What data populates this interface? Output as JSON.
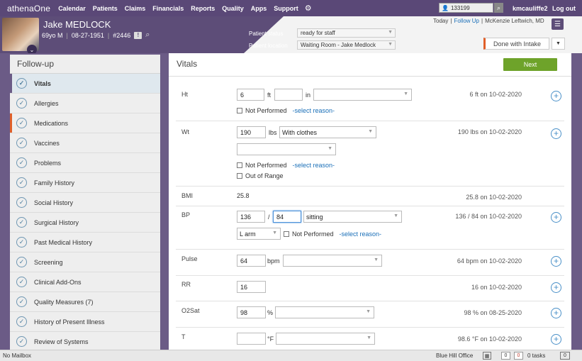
{
  "nav": {
    "logo": "athenaOne",
    "items": [
      "Calendar",
      "Patients",
      "Claims",
      "Financials",
      "Reports",
      "Quality",
      "Apps",
      "Support"
    ],
    "search_value": "133199",
    "username": "kmcauliffe2",
    "logout": "Log out"
  },
  "patient": {
    "name": "Jake MEDLOCK",
    "age_sex": "69yo M",
    "dob": "08-27-1951",
    "id": "#2446",
    "status_label": "Patient status",
    "status_value": "ready for staff",
    "location_label": "Patient location",
    "location_value": "Waiting Room - Jake Medlock"
  },
  "header_right": {
    "today": "Today",
    "sep": "|",
    "follow_up": "Follow Up",
    "provider": "McKenzie Leftwich, MD",
    "done_button": "Done with Intake"
  },
  "sidebar": {
    "title": "Follow-up",
    "items": [
      "Vitals",
      "Allergies",
      "Medications",
      "Vaccines",
      "Problems",
      "Family History",
      "Social History",
      "Surgical History",
      "Past Medical History",
      "Screening",
      "Clinical Add-Ons",
      "Quality Measures  (7)",
      "History of Present Illness",
      "Review of Systems"
    ]
  },
  "main": {
    "title": "Vitals",
    "next_button": "Next",
    "not_performed": "Not Performed",
    "select_reason": "-select reason-",
    "out_of_range": "Out of Range",
    "ht": {
      "label": "Ht",
      "value1": "6",
      "unit1": "ft",
      "value2": "",
      "unit2": "in",
      "last": "6 ft on 10-02-2020"
    },
    "wt": {
      "label": "Wt",
      "value": "190",
      "unit": "lbs",
      "clothing": "With clothes",
      "last": "190 lbs on 10-02-2020"
    },
    "bmi": {
      "label": "BMI",
      "value": "25.8",
      "last": "25.8 on 10-02-2020"
    },
    "bp": {
      "label": "BP",
      "systolic": "136",
      "slash": "/",
      "diastolic": "84",
      "position": "sitting",
      "site": "L arm",
      "last": "136 / 84 on 10-02-2020"
    },
    "pulse": {
      "label": "Pulse",
      "value": "64",
      "unit": "bpm",
      "last": "64 bpm on 10-02-2020"
    },
    "rr": {
      "label": "RR",
      "value": "16",
      "last": "16 on 10-02-2020"
    },
    "o2": {
      "label": "O2Sat",
      "value": "98",
      "unit": "%",
      "last": "98 % on 08-25-2020"
    },
    "temp": {
      "label": "T",
      "value": "",
      "unit": "°F",
      "last": "98.6 °F on 10-02-2020"
    }
  },
  "statusbar": {
    "mailbox": "No Mailbox",
    "office": "Blue Hill Office",
    "count1": "0",
    "count2": "0",
    "tasks": "0 tasks",
    "chat_count": "0"
  },
  "colors": {
    "nav": "#5a4877",
    "accent_green": "#6ea32a",
    "link_blue": "#1a6fb8",
    "alert_orange": "#e0602a"
  }
}
